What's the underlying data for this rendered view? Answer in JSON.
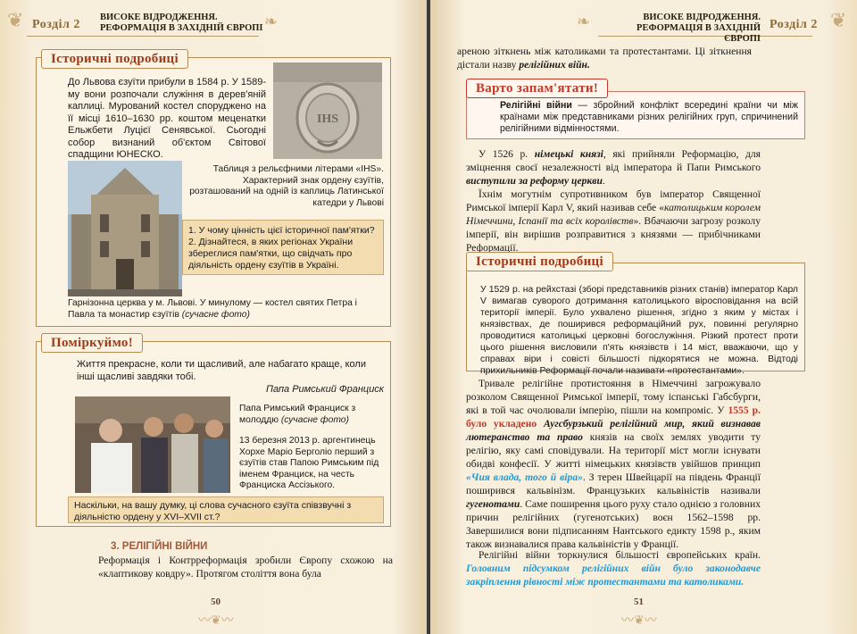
{
  "left": {
    "chapter": "Розділ 2",
    "runhead_1": "ВИСОКЕ ВІДРОДЖЕННЯ.",
    "runhead_2": "РЕФОРМАЦІЯ В ЗАХІДНІЙ ЄВРОПІ",
    "hist_tag": "Історичні подробиці",
    "hist_text": "До Львова єзуїти прибули в 1584 р. У 1589-му вони розпочали служіння в дерев'яній каплиці. Мурований костел споруджено на її місці 1610–1630 рр. коштом меценатки Ельжбети Луцієї Сенявської. Сьогодні собор визнаний об'єктом Світової спадщини ЮНЕСКО.",
    "ihs_caption": "Таблиця з рельєфними літерами «IHS». Характерний знак ордену єзуїтів, розташований на одній із каплиць Латинської катедри у Львові",
    "questions": [
      "1. У чому цінність цієї історичної пам'ятки?",
      "2. Дізнайтеся, в яких регіонах України збереглися пам'ятки, що свідчать про діяльність ордену єзуїтів в Україні."
    ],
    "church_caption_main": "Гарнізонна церква у м. Львові. У минулому — костел святих Петра і Павла та монастир єзуїтів ",
    "church_caption_note": "(сучасне фото)",
    "think_tag": "Поміркуймо!",
    "quote": "Життя прекрасне, коли ти щасливий, але набагато краще, коли інші щасливі завдяки тобі.",
    "quote_author": "Папа Римський Франциск",
    "pope_caption_main": "Папа Римський Франциск з молоддю ",
    "pope_caption_note": "(сучасне фото)",
    "pope_bio": "13 березня 2013 р. аргентинець Хорхе Маріо Берголіо перший з єзуїтів став Папою Римським під іменем Франциск, на честь Франциска Ассізького.",
    "think_question": "Наскільки, на вашу думку, ці слова сучасного єзуїта співзвучні з діяльністю ордену у XVI–XVII ст.?",
    "section_title": "3. РЕЛІГІЙНІ ВІЙНИ",
    "section_text": "Реформація і Контрреформація зробили Європу схожою на «клаптикову ковдру». Протягом століття вона була",
    "page_number": "50"
  },
  "right": {
    "chapter": "Розділ 2",
    "runhead_1": "ВИСОКЕ ВІДРОДЖЕННЯ.",
    "runhead_2": "РЕФОРМАЦІЯ В ЗАХІДНІЙ ЄВРОПІ",
    "top_text_1": "ареною зіткнень між католиками та протестантами. Ці зіткнення дістали назву ",
    "top_term": "релігійних війн.",
    "remember_tag": "Варто запам'ятати!",
    "def_term": "Релігійні війни",
    "def_text": " — збройний конфлікт всередині країни чи між країнами між представниками різних релігійних груп, спричинений релігійними відмінностями.",
    "p1_a": "У 1526 р. ",
    "p1_b": "німецькі князі",
    "p1_c": ", які прийняли Реформацію, для зміцнення своєї незалежності від імператора й Папи Римського ",
    "p1_d": "виступили за реформу церкви",
    "p1_e": ".",
    "p2_a": "Їхнім могутнім супротивником був імператор Священної Римської імперії Карл V, який називав себе «",
    "p2_b": "католицьким королем Німеччини, Іспанії та всіх королівств",
    "p2_c": "». Вбачаючи загрозу розколу імперії, він вирішив розправитися з князями — прибічниками Реформації.",
    "hist_tag": "Історичні подробиці",
    "hist_text": "У 1529 р. на рейхстазі (зборі представників різних станів) імператор Карл V вимагав суворого дотримання католицького віросповідання на всій території імперії. Було ухвалено рішення, згідно з яким у містах і князівствах, де поширився реформаційний рух, повинні регулярно проводитися католицькі церковні богослужіння. Різкий протест проти цього рішення висловили п'ять князівств і 14 міст, вважаючи, що у справах віри і совісті більшості підкорятися не можна. Відтоді прихильників Реформації почали називати «протестантами».",
    "p3_a": "Тривале релігійне протистояння в Німеччині загрожувало розколом Священної Римської імперії, тому іспанські Габсбурги, які в той час очолювали імперію, пішли на компроміс. У ",
    "p3_red": "1555 р. було укладено",
    "p3_b": " Аугсбурзький релігійний мир, який визнавав лютеранство та право",
    "p3_c": " князів на своїх землях уводити ту релігію, яку самі сповідували. На території міст могли існувати обидві конфесії. У житті німецьких князівств увійшов принцип ",
    "p3_blue": "«Чия влада, того й віра»",
    "p3_d": ". З терен Швейцарії на південь Франції поширився кальвінізм. Французьких кальвіністів називали ",
    "p3_e": "гугенотами",
    "p3_f": ". Саме поширення цього руху стало однією з головних причин релігійних (гугенотських) воєн 1562–1598 рр. Завершилися вони підписанням Нантського едикту 1598 р., яким також визнавалися права кальвіністів у Франції.",
    "p4_a": "Релігійні війни торкнулися більшості європейських країн. ",
    "p4_blue": "Головним підсумком релігійних війн було законодавче закріплення рівності між протестантами та католиками.",
    "page_number": "51"
  },
  "colors": {
    "accent_red": "#c0392b",
    "accent_blue": "#1e9ad6",
    "frame": "#b58a55",
    "paper": "#f7eedc"
  }
}
